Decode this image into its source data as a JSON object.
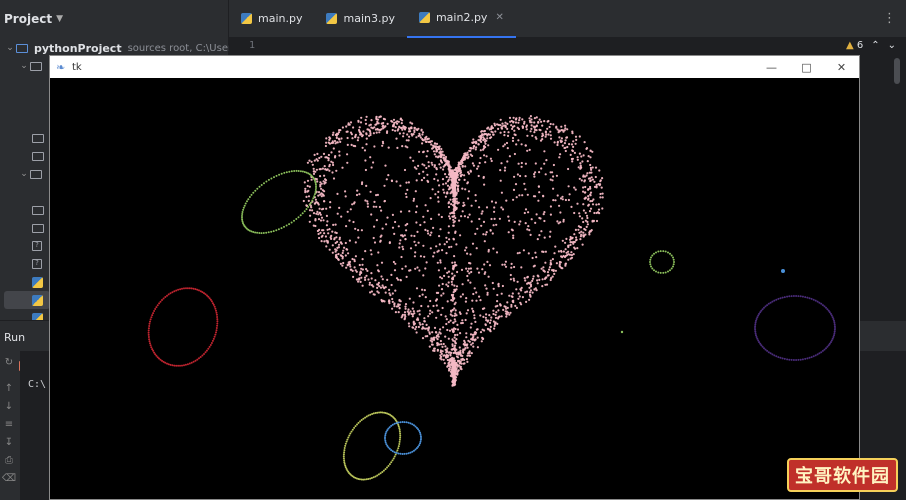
{
  "project": {
    "header": "Project",
    "root_name": "pythonProject",
    "root_note": "sources root,  C:\\Users\\ya"
  },
  "tabs": [
    {
      "label": "main.py",
      "active": false
    },
    {
      "label": "main3.py",
      "active": false
    },
    {
      "label": "main2.py",
      "active": true
    }
  ],
  "editor": {
    "line_number": "1",
    "warnings": "6"
  },
  "run": {
    "label": "Run",
    "console_text": "C:\\"
  },
  "tk": {
    "title": "tk"
  },
  "watermark": "宝哥软件园",
  "colors": {
    "heart": "#f4b8c4",
    "ring_green": "#8bbf5b",
    "ring_red": "#c0242f",
    "ring_blue": "#4a90d8",
    "ring_olive": "#b9c45a",
    "ring_purple": "#4a2c7a",
    "accent": "#3574f0"
  }
}
